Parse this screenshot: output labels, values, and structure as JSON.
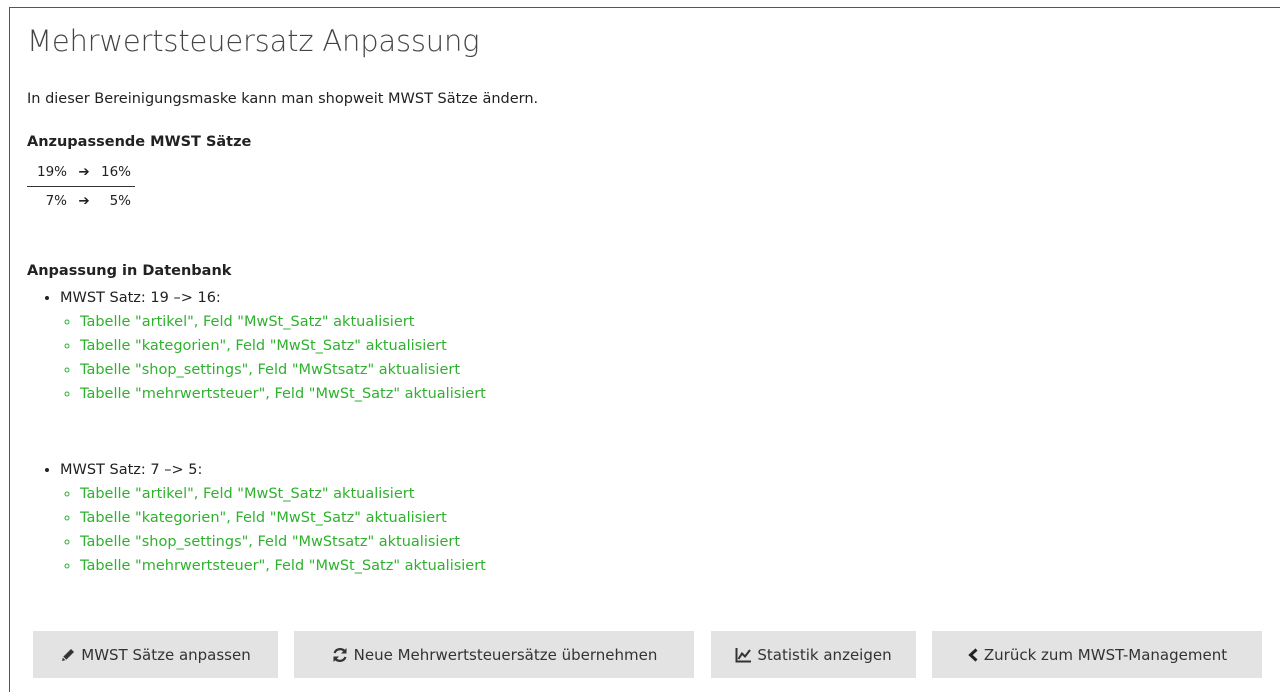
{
  "page": {
    "title": "Mehrwertsteuersatz Anpassung",
    "intro": "In dieser Bereinigungsmaske kann man shopweit MWST Sätze ändern."
  },
  "rates": {
    "heading": "Anzupassende MWST Sätze",
    "rows": [
      {
        "from": "19%",
        "to": "16%"
      },
      {
        "from": "7%",
        "to": "5%"
      }
    ]
  },
  "database": {
    "heading": "Anpassung in Datenbank",
    "groups": [
      {
        "label": "MWST Satz: 19 –> 16:",
        "items": [
          "Tabelle \"artikel\", Feld \"MwSt_Satz\" aktualisiert",
          "Tabelle \"kategorien\", Feld \"MwSt_Satz\" aktualisiert",
          "Tabelle \"shop_settings\", Feld \"MwStsatz\" aktualisiert",
          "Tabelle \"mehrwertsteuer\", Feld \"MwSt_Satz\" aktualisiert"
        ]
      },
      {
        "label": "MWST Satz: 7 –> 5:",
        "items": [
          "Tabelle \"artikel\", Feld \"MwSt_Satz\" aktualisiert",
          "Tabelle \"kategorien\", Feld \"MwSt_Satz\" aktualisiert",
          "Tabelle \"shop_settings\", Feld \"MwStsatz\" aktualisiert",
          "Tabelle \"mehrwertsteuer\", Feld \"MwSt_Satz\" aktualisiert"
        ]
      }
    ]
  },
  "buttons": {
    "adjust": {
      "label": "MWST Sätze anpassen",
      "icon": "pencil-icon"
    },
    "apply": {
      "label": "Neue Mehrwertsteuersätze übernehmen",
      "icon": "refresh-icon"
    },
    "stats": {
      "label": "Statistik anzeigen",
      "icon": "line-chart-icon"
    },
    "back": {
      "label": "Zurück zum MWST-Management",
      "icon": "chevron-left-icon"
    }
  },
  "colors": {
    "success_text": "#2fb12f",
    "button_bg": "#e3e3e3"
  }
}
